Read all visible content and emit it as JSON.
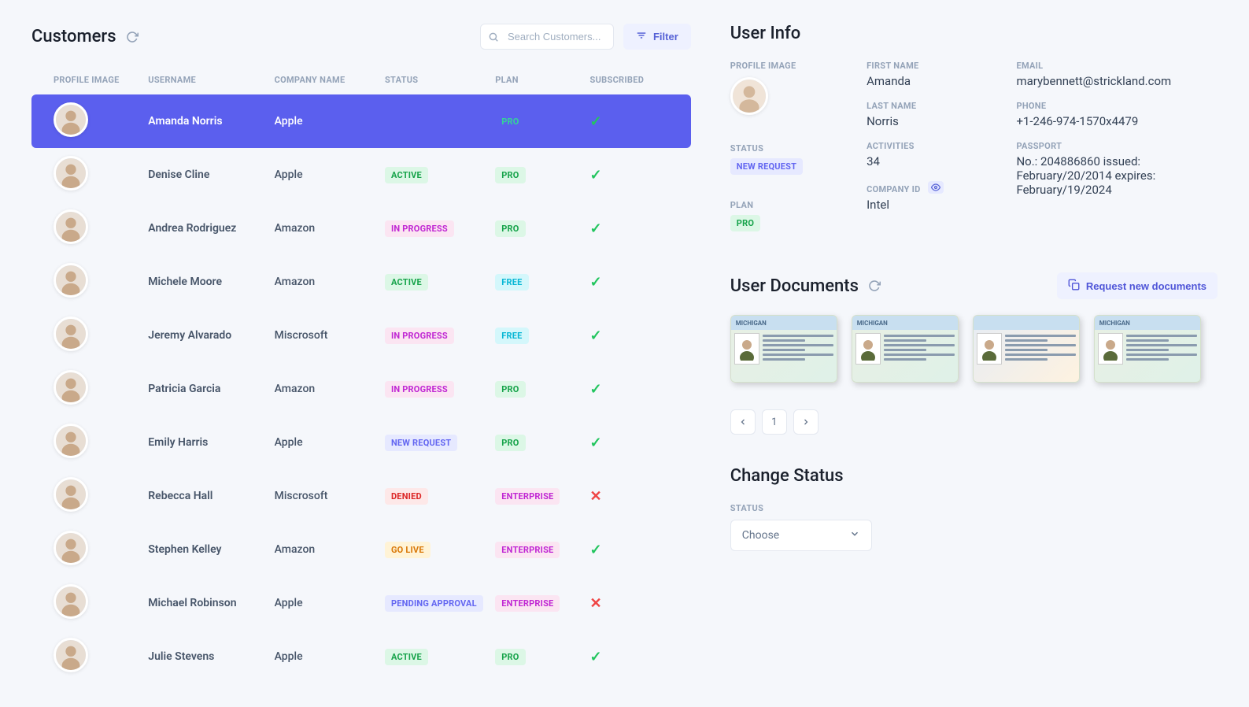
{
  "customers": {
    "title": "Customers",
    "search_placeholder": "Search Customers...",
    "filter_label": "Filter",
    "columns": {
      "profile": "PROFILE IMAGE",
      "username": "USERNAME",
      "company": "COMPANY NAME",
      "status": "STATUS",
      "plan": "PLAN",
      "subscribed": "SUBSCRIBED"
    },
    "rows": [
      {
        "username": "Amanda Norris",
        "company": "Apple",
        "status": "",
        "status_class": "",
        "plan": "PRO",
        "plan_class": "b-pro",
        "subscribed": true,
        "selected": true
      },
      {
        "username": "Denise Cline",
        "company": "Apple",
        "status": "ACTIVE",
        "status_class": "b-active",
        "plan": "PRO",
        "plan_class": "b-pro",
        "subscribed": true,
        "selected": false
      },
      {
        "username": "Andrea Rodriguez",
        "company": "Amazon",
        "status": "IN PROGRESS",
        "status_class": "b-inprogress",
        "plan": "PRO",
        "plan_class": "b-pro",
        "subscribed": true,
        "selected": false
      },
      {
        "username": "Michele Moore",
        "company": "Amazon",
        "status": "ACTIVE",
        "status_class": "b-active",
        "plan": "FREE",
        "plan_class": "b-free",
        "subscribed": true,
        "selected": false
      },
      {
        "username": "Jeremy Alvarado",
        "company": "Miscrosoft",
        "status": "IN PROGRESS",
        "status_class": "b-inprogress",
        "plan": "FREE",
        "plan_class": "b-free",
        "subscribed": true,
        "selected": false
      },
      {
        "username": "Patricia Garcia",
        "company": "Amazon",
        "status": "IN PROGRESS",
        "status_class": "b-inprogress",
        "plan": "PRO",
        "plan_class": "b-pro",
        "subscribed": true,
        "selected": false
      },
      {
        "username": "Emily Harris",
        "company": "Apple",
        "status": "NEW REQUEST",
        "status_class": "b-newrequest",
        "plan": "PRO",
        "plan_class": "b-pro",
        "subscribed": true,
        "selected": false
      },
      {
        "username": "Rebecca Hall",
        "company": "Miscrosoft",
        "status": "DENIED",
        "status_class": "b-denied",
        "plan": "ENTERPRISE",
        "plan_class": "b-enterprise",
        "subscribed": false,
        "selected": false
      },
      {
        "username": "Stephen Kelley",
        "company": "Amazon",
        "status": "GO LIVE",
        "status_class": "b-golive",
        "plan": "ENTERPRISE",
        "plan_class": "b-enterprise",
        "subscribed": true,
        "selected": false
      },
      {
        "username": "Michael Robinson",
        "company": "Apple",
        "status": "PENDING APPROVAL",
        "status_class": "b-pending",
        "plan": "ENTERPRISE",
        "plan_class": "b-enterprise",
        "subscribed": false,
        "selected": false
      },
      {
        "username": "Julie Stevens",
        "company": "Apple",
        "status": "ACTIVE",
        "status_class": "b-active",
        "plan": "PRO",
        "plan_class": "b-pro",
        "subscribed": true,
        "selected": false
      }
    ]
  },
  "user_info": {
    "title": "User Info",
    "labels": {
      "profile": "PROFILE IMAGE",
      "status": "STATUS",
      "plan": "PLAN",
      "first_name": "FIRST NAME",
      "last_name": "LAST NAME",
      "activities": "ACTIVITIES",
      "company_id": "COMPANY ID",
      "email": "EMAIL",
      "phone": "PHONE",
      "passport": "PASSPORT"
    },
    "status": "NEW REQUEST",
    "plan": "PRO",
    "first_name": "Amanda",
    "last_name": "Norris",
    "activities": "34",
    "company_id": "Intel",
    "email": "marybennett@strickland.com",
    "phone": "+1-246-974-1570x4479",
    "passport": "No.: 204886860 issued: February/20/2014 expires: February/19/2024"
  },
  "documents": {
    "title": "User Documents",
    "request_label": "Request new documents",
    "card_label": "MICHIGAN",
    "count": 4,
    "page": "1"
  },
  "change_status": {
    "title": "Change Status",
    "label": "STATUS",
    "placeholder": "Choose"
  }
}
